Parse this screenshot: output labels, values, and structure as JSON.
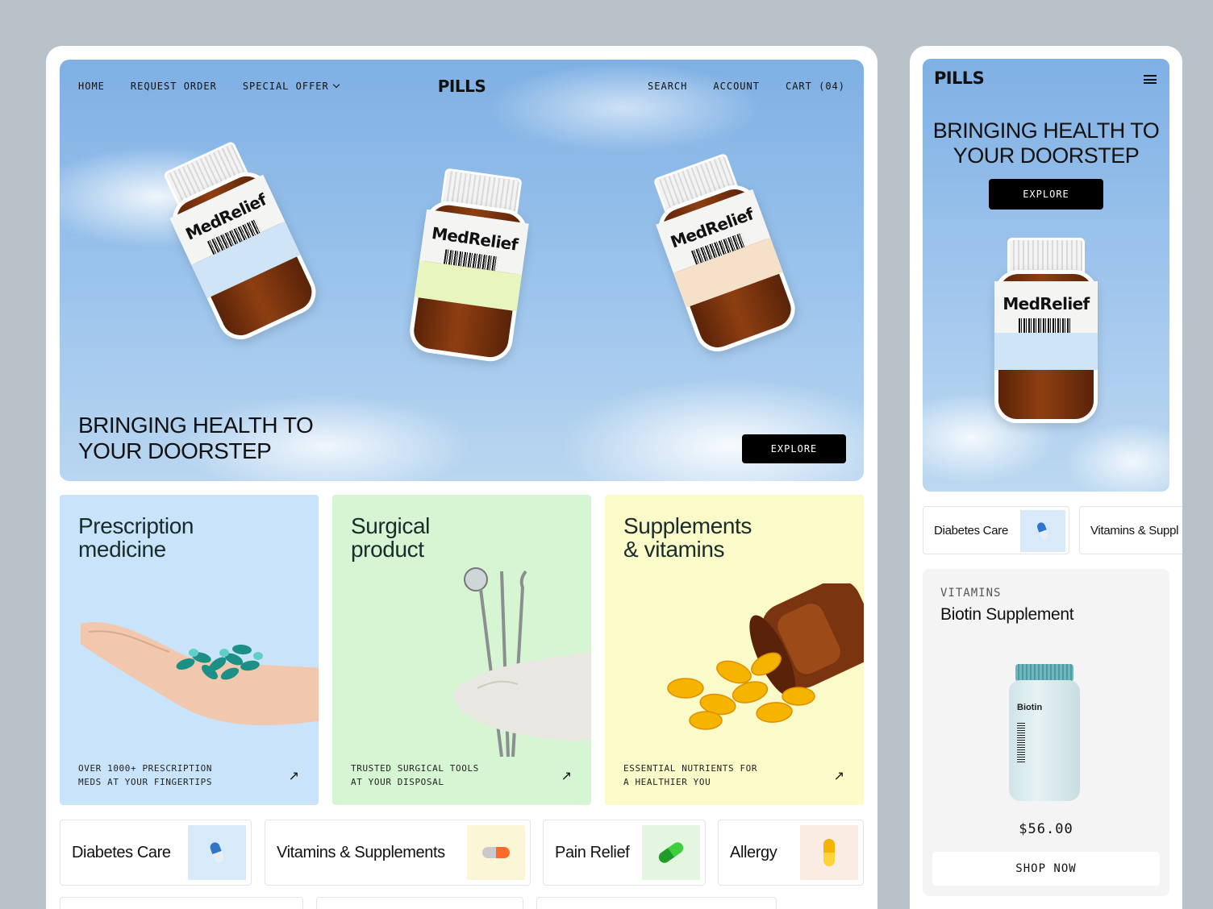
{
  "desktop": {
    "nav": {
      "left": [
        "HOME",
        "REQUEST ORDER",
        "SPECIAL OFFER"
      ],
      "logo": "PILLS",
      "right": [
        "SEARCH",
        "ACCOUNT",
        "CART (04)"
      ]
    },
    "hero": {
      "bottle_brand": "MedRelief",
      "title_line1": "BRINGING HEALTH TO",
      "title_line2": "YOUR DOORSTEP",
      "cta": "EXPLORE"
    },
    "categories": [
      {
        "title_l1": "Prescription",
        "title_l2": "medicine",
        "sub_l1": "OVER 1000+ PRESCRIPTION",
        "sub_l2": "MEDS AT YOUR FINGERTIPS",
        "color": "#c9e3fb"
      },
      {
        "title_l1": "Surgical",
        "title_l2": "product",
        "sub_l1": "TRUSTED SURGICAL TOOLS",
        "sub_l2": "AT YOUR DISPOSAL",
        "color": "#d6f6d3"
      },
      {
        "title_l1": "Supplements",
        "title_l2": "& vitamins",
        "sub_l1": "ESSENTIAL NUTRIENTS FOR",
        "sub_l2": "A HEALTHIER YOU",
        "color": "#fbfbc9"
      }
    ],
    "chips": [
      {
        "label": "Diabetes Care",
        "thumb_bg": "#d8eaf9"
      },
      {
        "label": "Vitamins & Supplements",
        "thumb_bg": "#fbf7d6"
      },
      {
        "label": "Pain Relief",
        "thumb_bg": "#e4f6e1"
      },
      {
        "label": "Allergy",
        "thumb_bg": "#fbece3"
      }
    ]
  },
  "mobile": {
    "logo": "PILLS",
    "title_line1": "BRINGING HEALTH TO",
    "title_line2": "YOUR DOORSTEP",
    "cta": "EXPLORE",
    "bottle_brand": "MedRelief",
    "chips": [
      "Diabetes Care",
      "Vitamins & Suppl"
    ],
    "product": {
      "category": "VITAMINS",
      "name": "Biotin Supplement",
      "bottle_label": "Biotin",
      "price": "$56.00",
      "cta": "SHOP NOW"
    }
  }
}
